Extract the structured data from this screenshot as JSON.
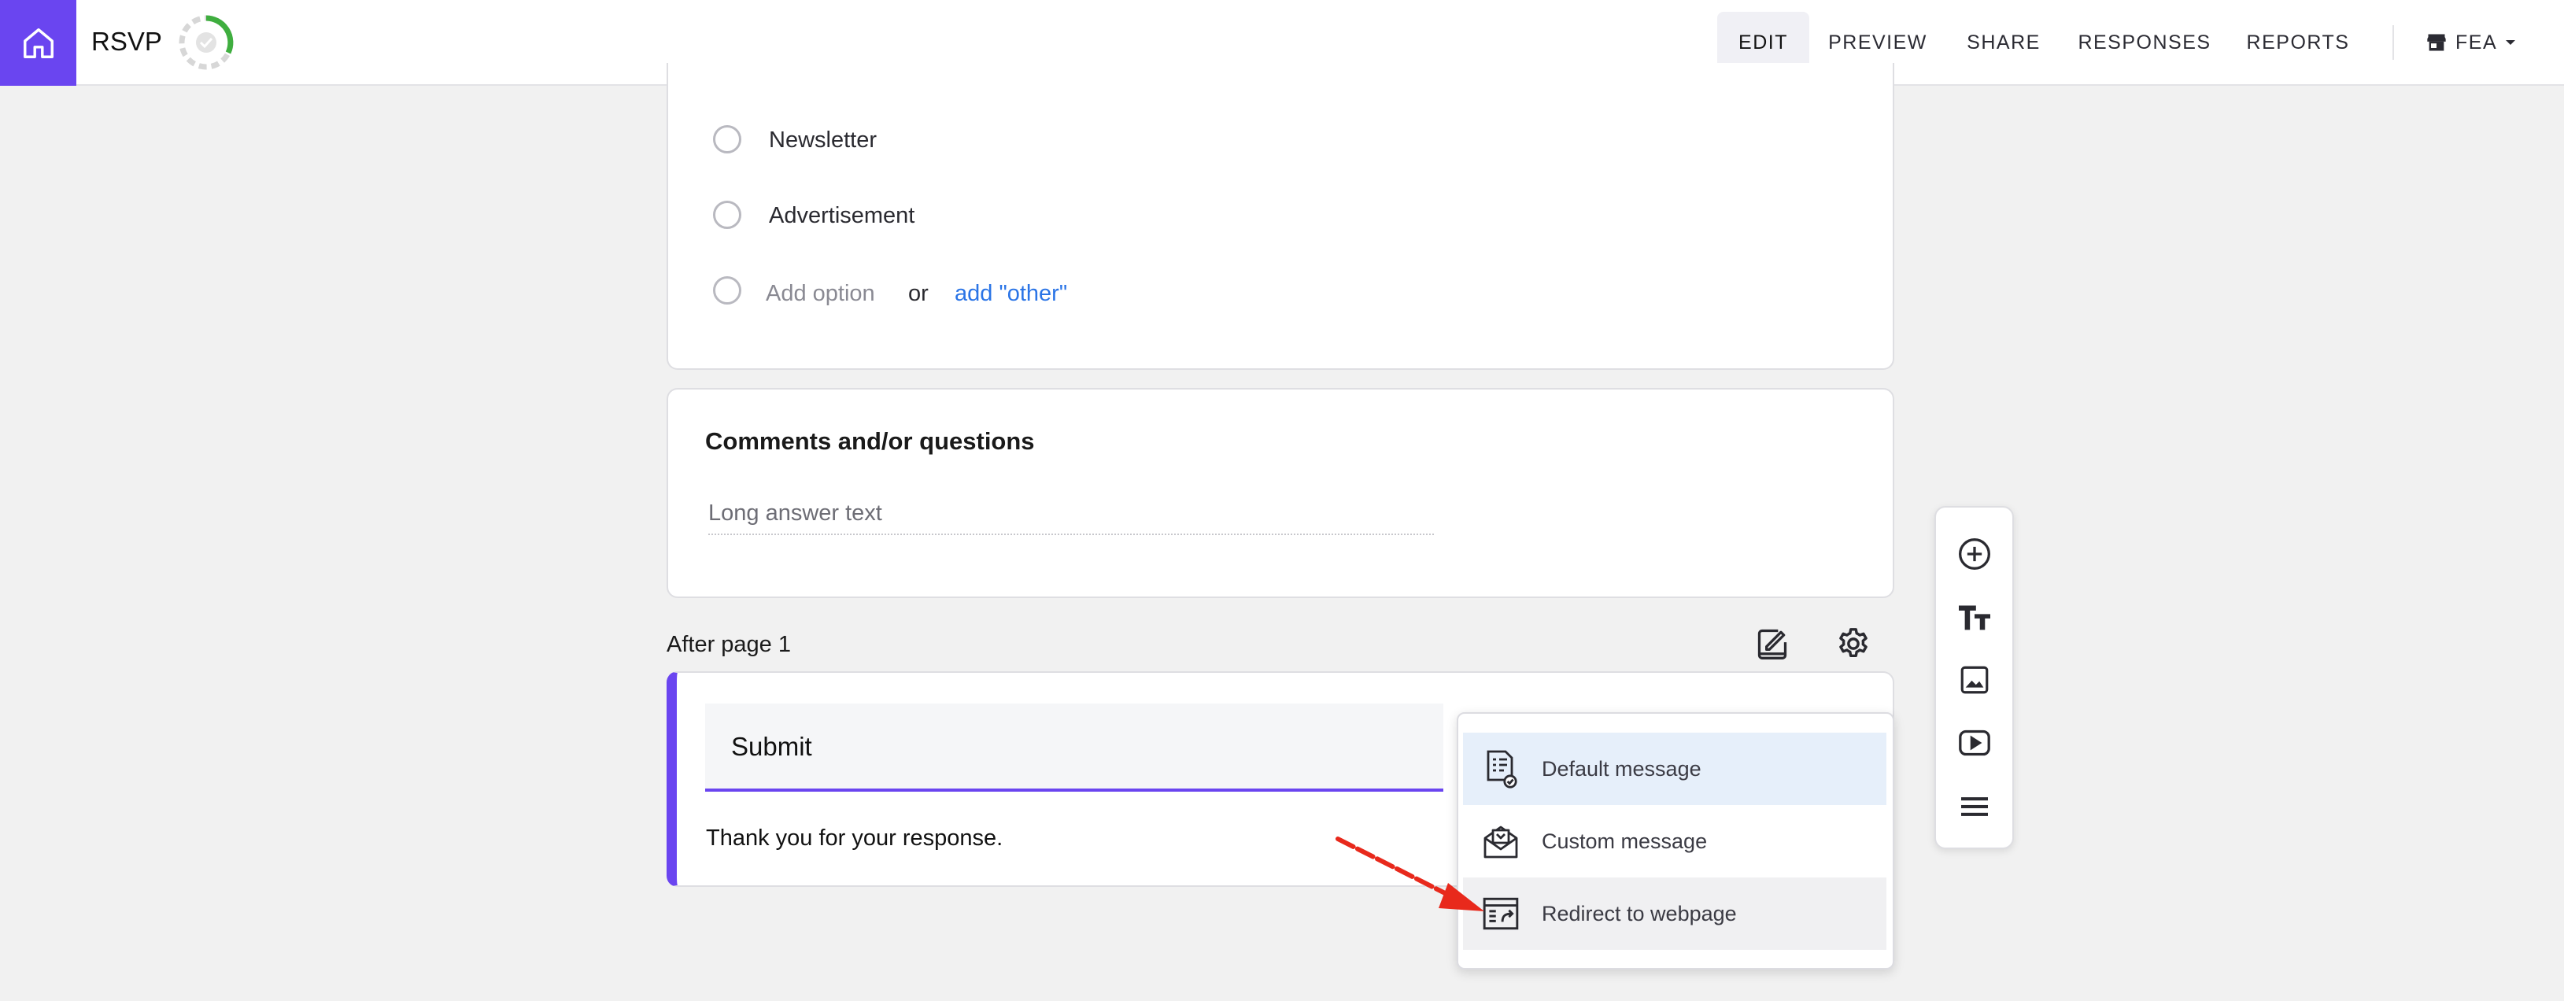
{
  "app": {
    "title": "RSVP",
    "brand_color": "#6a45f0",
    "home_icon": "home-icon",
    "status_icon": "save-status-ring"
  },
  "nav": {
    "tabs": [
      {
        "label": "EDIT",
        "active": true
      },
      {
        "label": "PREVIEW",
        "active": false
      },
      {
        "label": "SHARE",
        "active": false
      },
      {
        "label": "RESPONSES",
        "active": false
      },
      {
        "label": "REPORTS",
        "active": false
      }
    ],
    "workspace": {
      "icon": "store-icon",
      "label": "FEA"
    }
  },
  "question1": {
    "options": [
      "Newsletter",
      "Advertisement"
    ],
    "add_option": "Add option",
    "or_text": "or",
    "add_other": "add \"other\""
  },
  "question2": {
    "title": "Comments and/or questions",
    "placeholder": "Long answer text"
  },
  "after_page": {
    "label": "After page 1",
    "logic_icon": "edit-logic-icon",
    "settings_icon": "gear-icon"
  },
  "submit": {
    "button_label": "Submit",
    "message": "Thank you for your response."
  },
  "ending_menu": {
    "items": [
      {
        "label": "Default message",
        "icon": "document-check-icon",
        "highlighted": true
      },
      {
        "label": "Custom message",
        "icon": "envelope-icon",
        "highlighted": false
      },
      {
        "label": "Redirect to webpage",
        "icon": "browser-redirect-icon",
        "highlighted": false
      }
    ]
  },
  "toolbar": {
    "items": [
      "add-question-icon",
      "title-text-icon",
      "image-icon",
      "video-icon",
      "section-divider-icon"
    ]
  },
  "annotation": {
    "color": "#e8291c"
  }
}
